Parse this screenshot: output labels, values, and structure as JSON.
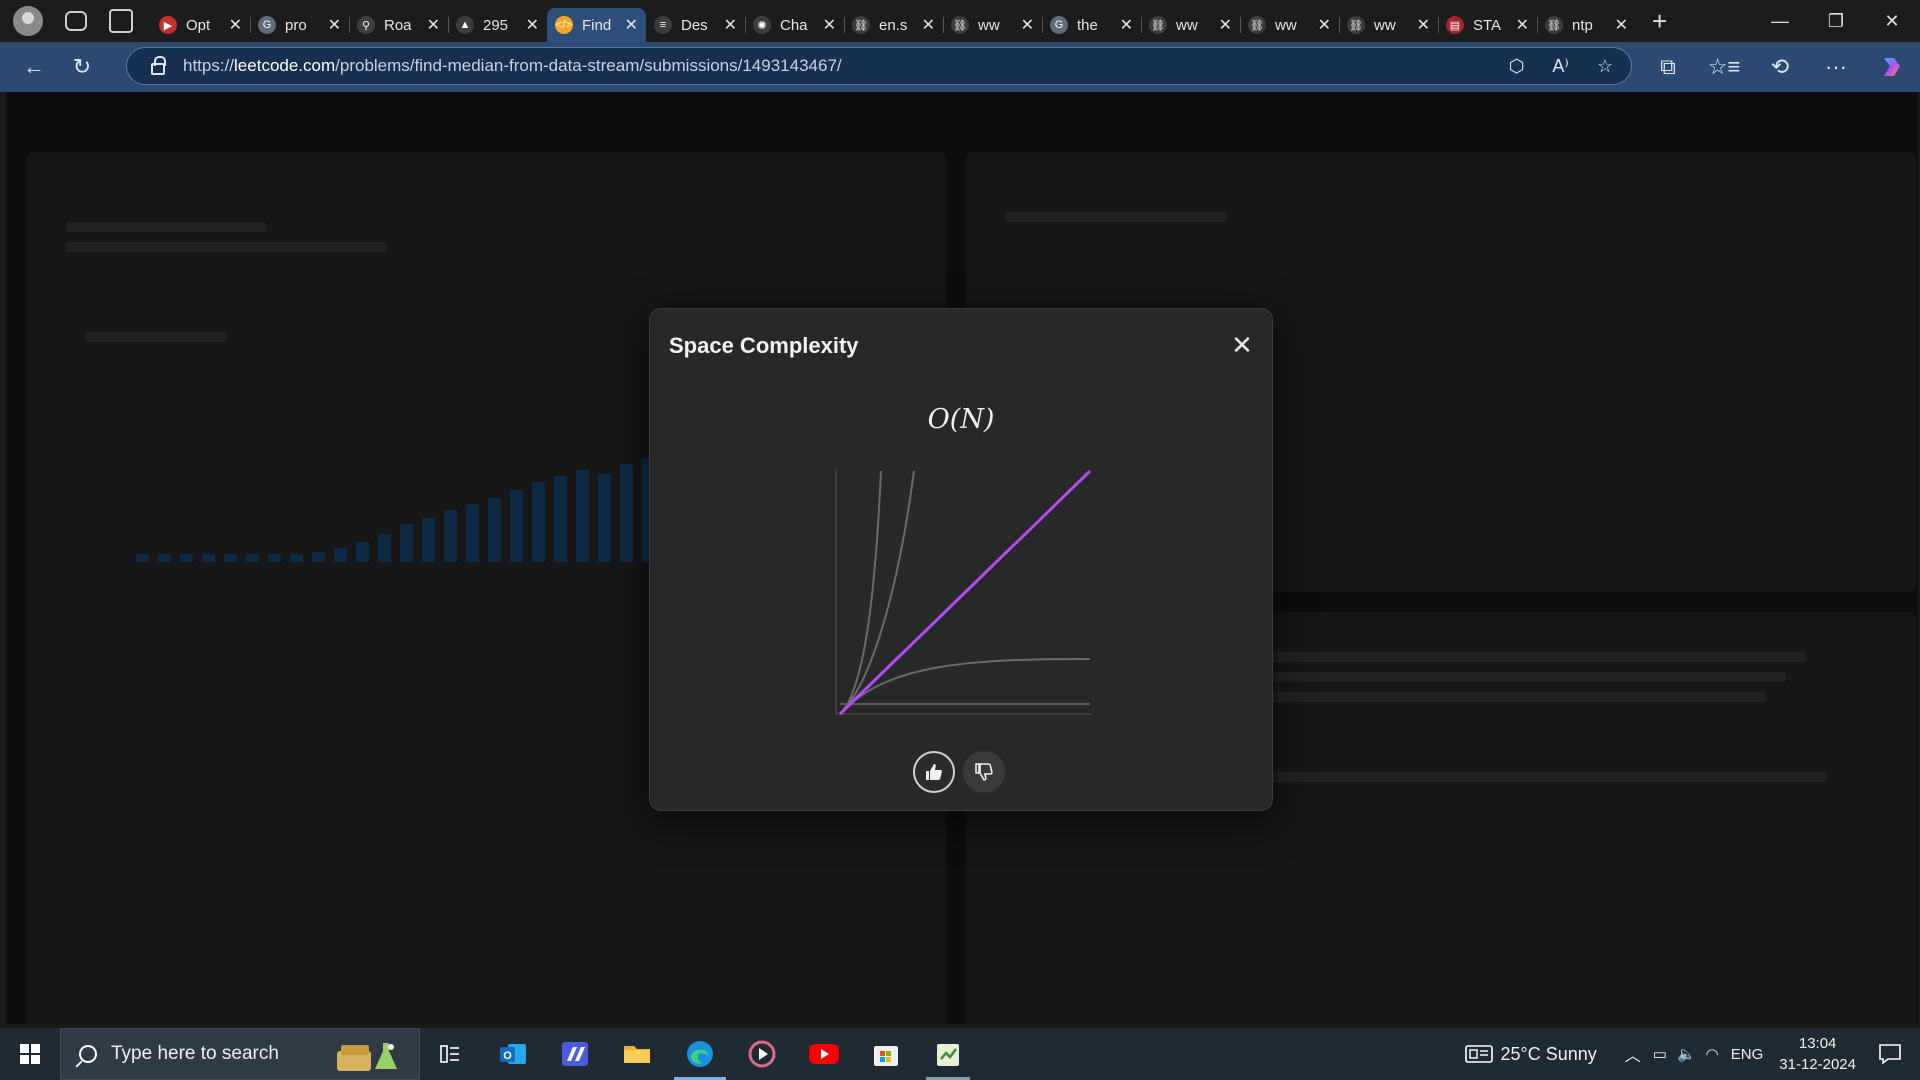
{
  "browser": {
    "tabs": [
      {
        "label": "Opt",
        "color": "#c4302b",
        "glyph": "▶"
      },
      {
        "label": "pro",
        "color": "#5f6b7a",
        "glyph": "G"
      },
      {
        "label": "Roa",
        "color": "#3d3d3d",
        "glyph": "⚲"
      },
      {
        "label": "295",
        "color": "#3d3d3d",
        "glyph": "▲"
      },
      {
        "label": "Find",
        "color": "#f5a623",
        "glyph": "</>",
        "active": true
      },
      {
        "label": "Des",
        "color": "#3d3d3d",
        "glyph": "≡"
      },
      {
        "label": "Cha",
        "color": "#3d3d3d",
        "glyph": "✺"
      },
      {
        "label": "en.s",
        "color": "#3d3d3d",
        "glyph": "⛓"
      },
      {
        "label": "ww",
        "color": "#3d3d3d",
        "glyph": "⛓"
      },
      {
        "label": "the",
        "color": "#5f6b7a",
        "glyph": "G"
      },
      {
        "label": "ww",
        "color": "#3d3d3d",
        "glyph": "⛓"
      },
      {
        "label": "ww",
        "color": "#3d3d3d",
        "glyph": "⛓"
      },
      {
        "label": "ww",
        "color": "#3d3d3d",
        "glyph": "⛓"
      },
      {
        "label": "STA",
        "color": "#a1262e",
        "glyph": "▤"
      },
      {
        "label": "ntp",
        "color": "#3d3d3d",
        "glyph": "⛓"
      }
    ],
    "close_glyph": "✕",
    "new_tab_glyph": "+",
    "window_controls": {
      "minimize": "—",
      "restore": "❐",
      "close": "✕"
    },
    "url_prefix": "https://",
    "url_host": "leetcode.com",
    "url_path": "/problems/find-median-from-data-stream/submissions/1493143467/",
    "nav_icons": {
      "back": "←",
      "refresh": "↻",
      "read_aloud": "A⁾",
      "favorite": "☆",
      "extensions": "⧉",
      "favorites": "☆≡",
      "history": "⟲",
      "more": "···"
    }
  },
  "modal": {
    "title": "Space Complexity",
    "complexity": "O(N)",
    "close_glyph": "✕",
    "highlight_color": "#b34bf2",
    "like_glyph": "👍",
    "dislike_glyph": "👎"
  },
  "taskbar": {
    "search_placeholder": "Type here to search",
    "weather": "25°C  Sunny",
    "language": "ENG",
    "time": "13:04",
    "date": "31-12-2024"
  }
}
